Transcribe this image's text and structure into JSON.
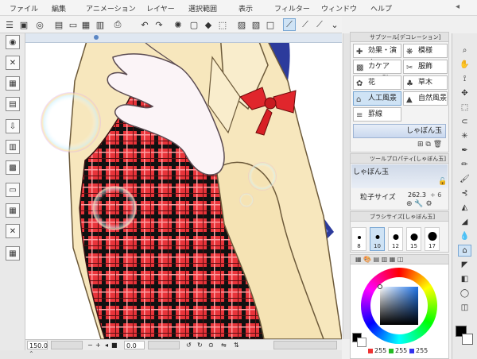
{
  "menu": [
    "ファイル",
    "編集",
    "アニメーション",
    "レイヤー",
    "選択範囲",
    "表示",
    "フィルター",
    "ウィンドウ",
    "ヘルプ"
  ],
  "decoration_panel": {
    "title": "サブツール[デコレーション]",
    "items": [
      {
        "label": "効果・演出",
        "icon": "effect-icon"
      },
      {
        "label": "模様",
        "icon": "pattern-icon"
      },
      {
        "label": "カケアミ・砂",
        "icon": "crosshatch-icon"
      },
      {
        "label": "服飾",
        "icon": "clothing-icon"
      },
      {
        "label": "花",
        "icon": "flower-icon"
      },
      {
        "label": "草木",
        "icon": "plant-icon"
      },
      {
        "label": "人工風景",
        "icon": "house-icon"
      },
      {
        "label": "自然風景",
        "icon": "mountain-icon"
      },
      {
        "label": "罫線",
        "icon": "ruled-lines-icon"
      }
    ],
    "selected_brush": "しゃぼん玉"
  },
  "tool_property": {
    "title": "ツールプロパティ[しゃぼん玉]",
    "name": "しゃぼん玉",
    "param_label": "粒子サイズ",
    "param_value": "262.3"
  },
  "brush_size": {
    "title": "ブラシサイズ[しゃぼん玉]",
    "sizes": [
      "8",
      "10",
      "12",
      "15",
      "17"
    ]
  },
  "color": {
    "r": "255",
    "g": "255",
    "b": "255"
  },
  "status": {
    "zoom": "150.0",
    "angle": "0.0"
  }
}
